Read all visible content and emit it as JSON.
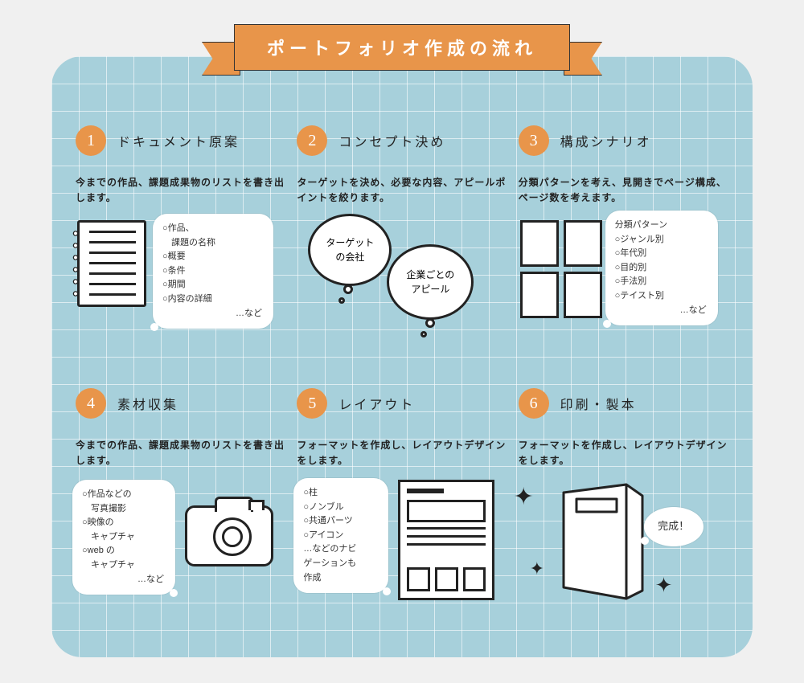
{
  "header": {
    "title": "ポートフォリオ作成の流れ"
  },
  "steps": [
    {
      "num": "1",
      "title": "ドキュメント原案",
      "desc": "今までの作品、課題成果物のリストを書き出します。",
      "bubble": {
        "items": [
          "○作品、",
          "　課題の名称",
          "○概要",
          "○条件",
          "○期間",
          "○内容の詳細"
        ],
        "etc": "…など"
      }
    },
    {
      "num": "2",
      "title": "コンセプト決め",
      "desc": "ターゲットを決め、必要な内容、アピールポイントを絞ります。",
      "circ1": "ターゲット\nの会社",
      "circ2": "企業ごとの\nアピール"
    },
    {
      "num": "3",
      "title": "構成シナリオ",
      "desc": "分類パターンを考え、見開きでページ構成、ページ数を考えます。",
      "bubble": {
        "lead": "分類パターン",
        "items": [
          "○ジャンル別",
          "○年代別",
          "○目的別",
          "○手法別",
          "○テイスト別"
        ],
        "etc": "…など"
      }
    },
    {
      "num": "4",
      "title": "素材収集",
      "desc": "今までの作品、課題成果物のリストを書き出します。",
      "bubble": {
        "items": [
          "○作品などの",
          "　写真撮影",
          "○映像の",
          "　キャプチャ",
          "○web の",
          "　キャプチャ"
        ],
        "etc": "…など"
      }
    },
    {
      "num": "5",
      "title": "レイアウト",
      "desc": "フォーマットを作成し、レイアウトデザインをします。",
      "bubble": {
        "items": [
          "○柱",
          "○ノンブル",
          "○共通パーツ",
          "○アイコン",
          "…などのナビ",
          "ゲーションも",
          "作成"
        ]
      }
    },
    {
      "num": "6",
      "title": "印刷・製本",
      "desc": "フォーマットを作成し、レイアウトデザインをします。",
      "done": "完成！"
    }
  ],
  "colors": {
    "accent": "#e8954a",
    "panel": "#a7d0db"
  }
}
